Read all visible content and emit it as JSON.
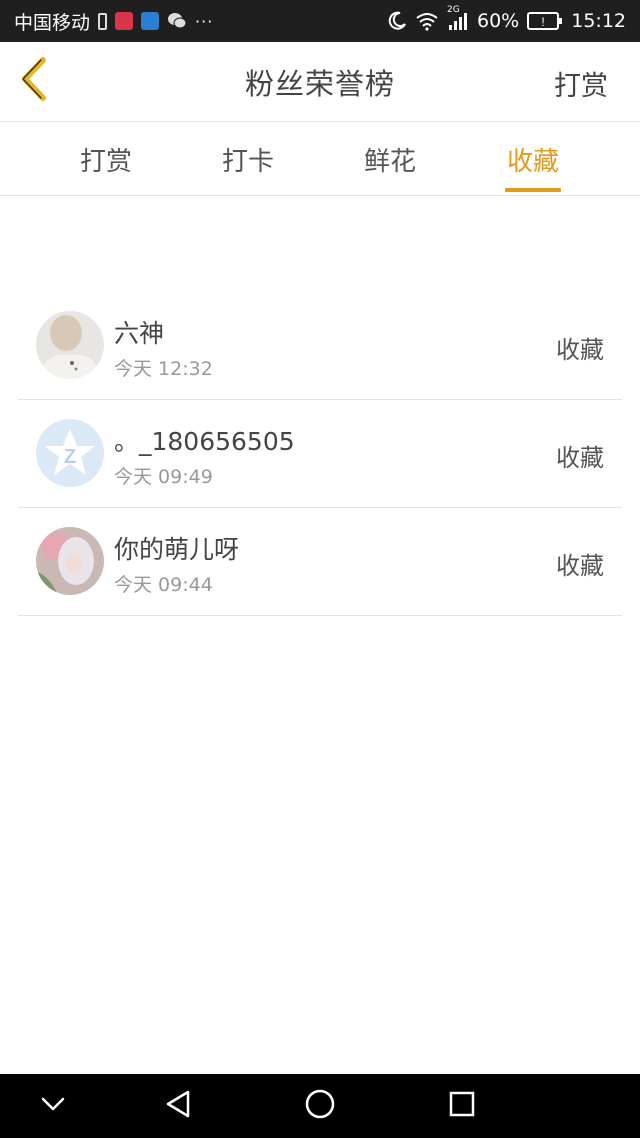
{
  "status_bar": {
    "carrier": "中国移动",
    "network": "2G",
    "battery": "60%",
    "time": "15:12",
    "icons": [
      "battery-saver-icon",
      "app-icon-news",
      "app-icon-video",
      "wechat-icon",
      "more-dots-icon",
      "moon-icon",
      "wifi-icon",
      "signal-icon",
      "battery-icon"
    ],
    "more": "···"
  },
  "header": {
    "title": "粉丝荣誉榜",
    "action_label": "打赏",
    "back_icon": "chevron-left-icon",
    "accent_color": "#e59a1a"
  },
  "tabs": [
    {
      "label": "打赏",
      "active": false
    },
    {
      "label": "打卡",
      "active": false
    },
    {
      "label": "鲜花",
      "active": false
    },
    {
      "label": "收藏",
      "active": true
    }
  ],
  "list": [
    {
      "name": "六神",
      "time": "今天 12:32",
      "action": "收藏"
    },
    {
      "name": "。_180656505",
      "time": "今天 09:49",
      "action": "收藏"
    },
    {
      "name": "你的萌儿呀",
      "time": "今天 09:44",
      "action": "收藏"
    }
  ],
  "nav_bar": {
    "buttons": [
      "chevron-down-icon",
      "back-triangle-icon",
      "home-circle-icon",
      "recents-square-icon"
    ]
  }
}
